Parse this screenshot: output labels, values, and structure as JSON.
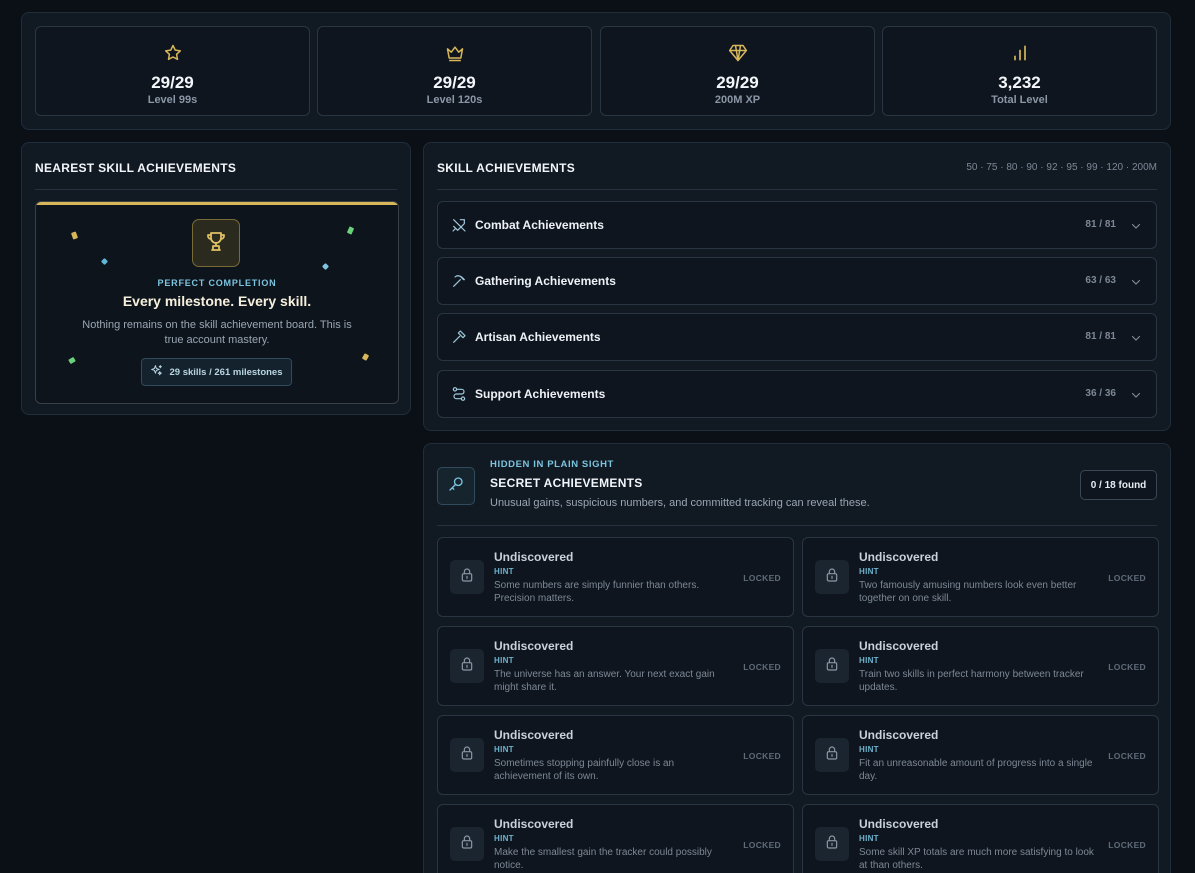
{
  "stats": [
    {
      "icon": "star-icon",
      "value": "29/29",
      "label": "Level 99s"
    },
    {
      "icon": "crown-icon",
      "value": "29/29",
      "label": "Level 120s"
    },
    {
      "icon": "diamond-icon",
      "value": "29/29",
      "label": "200M XP"
    },
    {
      "icon": "bar-chart-icon",
      "value": "3,232",
      "label": "Total Level"
    }
  ],
  "nearest": {
    "title": "NEAREST SKILL ACHIEVEMENTS",
    "tag": "PERFECT COMPLETION",
    "headline": "Every milestone. Every skill.",
    "description": "Nothing remains on the skill achievement board. This is true account mastery.",
    "pill": "29 skills / 261 milestones"
  },
  "skill_achievements": {
    "title": "SKILL ACHIEVEMENTS",
    "tiers": "50 · 75 · 80 · 90 · 92 · 95 · 99 · 120 · 200M",
    "groups": [
      {
        "icon": "swords-icon",
        "name": "Combat Achievements",
        "count": "81 / 81"
      },
      {
        "icon": "pickaxe-icon",
        "name": "Gathering Achievements",
        "count": "63 / 63"
      },
      {
        "icon": "hammer-icon",
        "name": "Artisan Achievements",
        "count": "81 / 81"
      },
      {
        "icon": "route-icon",
        "name": "Support Achievements",
        "count": "36 / 36"
      }
    ]
  },
  "secret": {
    "tag": "HIDDEN IN PLAIN SIGHT",
    "title": "SECRET ACHIEVEMENTS",
    "subtitle": "Unusual gains, suspicious numbers, and committed tracking can reveal these.",
    "found": "0 / 18 found",
    "cards": [
      {
        "title": "Undiscovered",
        "hint_label": "HINT",
        "hint": "Some numbers are simply funnier than others. Precision matters.",
        "status": "LOCKED"
      },
      {
        "title": "Undiscovered",
        "hint_label": "HINT",
        "hint": "Two famously amusing numbers look even better together on one skill.",
        "status": "LOCKED"
      },
      {
        "title": "Undiscovered",
        "hint_label": "HINT",
        "hint": "The universe has an answer. Your next exact gain might share it.",
        "status": "LOCKED"
      },
      {
        "title": "Undiscovered",
        "hint_label": "HINT",
        "hint": "Train two skills in perfect harmony between tracker updates.",
        "status": "LOCKED"
      },
      {
        "title": "Undiscovered",
        "hint_label": "HINT",
        "hint": "Sometimes stopping painfully close is an achievement of its own.",
        "status": "LOCKED"
      },
      {
        "title": "Undiscovered",
        "hint_label": "HINT",
        "hint": "Fit an unreasonable amount of progress into a single day.",
        "status": "LOCKED"
      },
      {
        "title": "Undiscovered",
        "hint_label": "HINT",
        "hint": "Make the smallest gain the tracker could possibly notice.",
        "status": "LOCKED"
      },
      {
        "title": "Undiscovered",
        "hint_label": "HINT",
        "hint": "Some skill XP totals are much more satisfying to look at than others.",
        "status": "LOCKED"
      }
    ]
  },
  "colors": {
    "gold": "#d8b75a",
    "accent": "#7cc4df",
    "background": "#0b1017",
    "panel": "#111923"
  }
}
